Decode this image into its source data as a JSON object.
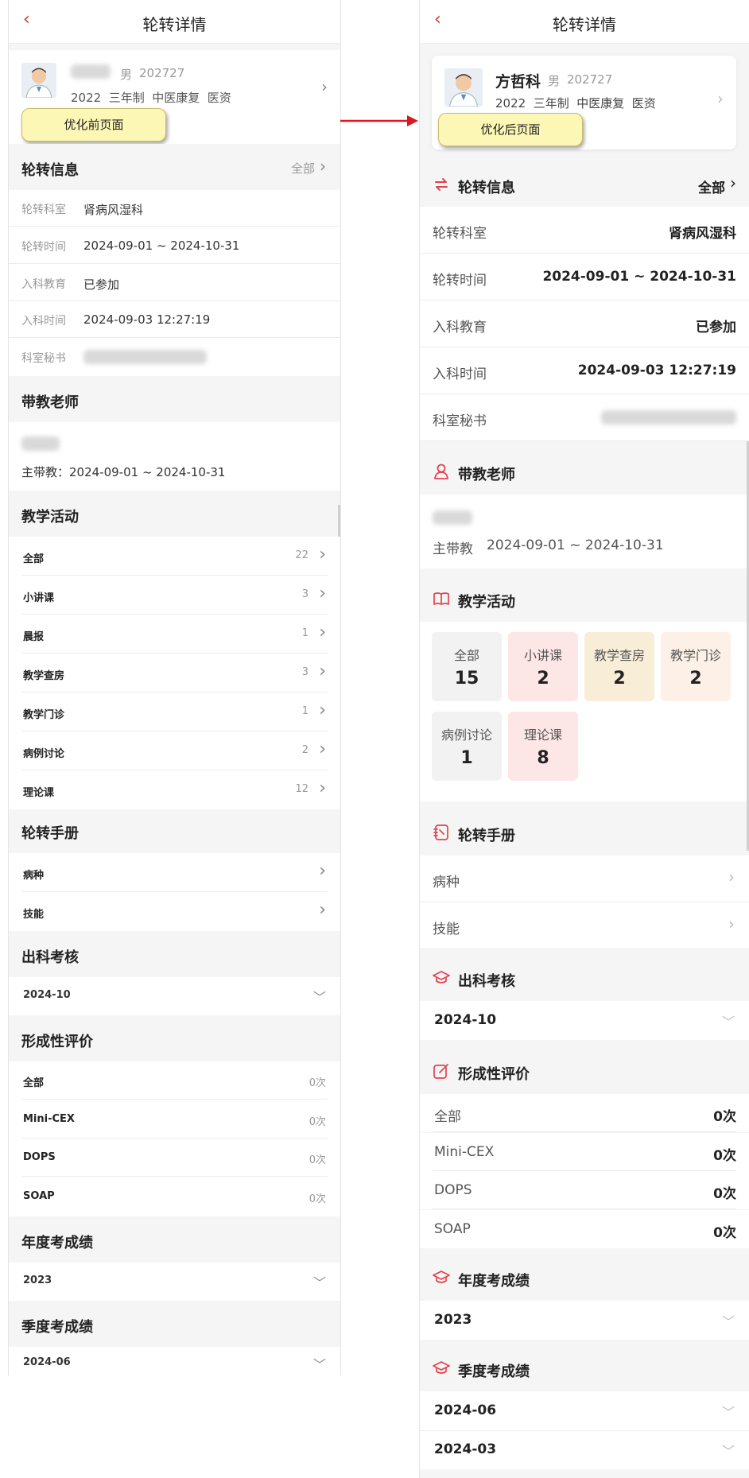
{
  "left": {
    "title": "轮转详情",
    "student": {
      "gender": "男",
      "id": "202727",
      "info": "2022  三年制  中医康复  医资"
    },
    "tooltip": "优化前页面",
    "rotation": {
      "header": "轮转信息",
      "all": "全部",
      "rows": [
        {
          "label": "轮转科室",
          "value": "肾病风湿科"
        },
        {
          "label": "轮转时间",
          "value": "2024-09-01 ~ 2024-10-31"
        },
        {
          "label": "入科教育",
          "value": "已参加"
        },
        {
          "label": "入科时间",
          "value": "2024-09-03 12:27:19"
        },
        {
          "label": "科室秘书",
          "value": ""
        }
      ]
    },
    "teacher": {
      "header": "带教老师",
      "line": "主带教：2024-09-01 ~ 2024-10-31"
    },
    "activities": {
      "header": "教学活动",
      "items": [
        {
          "label": "全部",
          "count": "22"
        },
        {
          "label": "小讲课",
          "count": "3"
        },
        {
          "label": "晨报",
          "count": "1"
        },
        {
          "label": "教学查房",
          "count": "3"
        },
        {
          "label": "教学门诊",
          "count": "1"
        },
        {
          "label": "病例讨论",
          "count": "2"
        },
        {
          "label": "理论课",
          "count": "12"
        }
      ]
    },
    "manual": {
      "header": "轮转手册",
      "items": [
        "病种",
        "技能"
      ]
    },
    "exam": {
      "header": "出科考核",
      "value": "2024-10"
    },
    "formative": {
      "header": "形成性评价",
      "items": [
        {
          "label": "全部",
          "value": "0次"
        },
        {
          "label": "Mini-CEX",
          "value": "0次"
        },
        {
          "label": "DOPS",
          "value": "0次"
        },
        {
          "label": "SOAP",
          "value": "0次"
        }
      ]
    },
    "annual": {
      "header": "年度考成绩",
      "value": "2023"
    },
    "quarterly": {
      "header": "季度考成绩",
      "value": "2024-06"
    }
  },
  "right": {
    "title": "轮转详情",
    "student": {
      "name": "方哲科",
      "gender": "男",
      "id": "202727",
      "info": "2022  三年制  中医康复  医资"
    },
    "tooltip": "优化后页面",
    "rotation": {
      "header": "轮转信息",
      "all": "全部",
      "rows": [
        {
          "label": "轮转科室",
          "value": "肾病风湿科"
        },
        {
          "label": "轮转时间",
          "value": "2024-09-01 ~ 2024-10-31"
        },
        {
          "label": "入科教育",
          "value": "已参加"
        },
        {
          "label": "入科时间",
          "value": "2024-09-03 12:27:19"
        },
        {
          "label": "科室秘书",
          "value": ""
        }
      ]
    },
    "teacher": {
      "header": "带教老师",
      "role": "主带教",
      "period": "2024-09-01 ~ 2024-10-31"
    },
    "activities": {
      "header": "教学活动",
      "tiles": [
        {
          "label": "全部",
          "count": "15",
          "color": "#f2f2f2"
        },
        {
          "label": "小讲课",
          "count": "2",
          "color": "#fde6e6"
        },
        {
          "label": "教学查房",
          "count": "2",
          "color": "#f8eed8"
        },
        {
          "label": "教学门诊",
          "count": "2",
          "color": "#fdf0e6"
        },
        {
          "label": "病例讨论",
          "count": "1",
          "color": "#f2f2f2"
        },
        {
          "label": "理论课",
          "count": "8",
          "color": "#fde6e6"
        }
      ]
    },
    "manual": {
      "header": "轮转手册",
      "items": [
        "病种",
        "技能"
      ]
    },
    "exam": {
      "header": "出科考核",
      "value": "2024-10"
    },
    "formative": {
      "header": "形成性评价",
      "items": [
        {
          "label": "全部",
          "value": "0次"
        },
        {
          "label": "Mini-CEX",
          "value": "0次"
        },
        {
          "label": "DOPS",
          "value": "0次"
        },
        {
          "label": "SOAP",
          "value": "0次"
        }
      ]
    },
    "annual": {
      "header": "年度考成绩",
      "value": "2023"
    },
    "quarterly": {
      "header": "季度考成绩",
      "values": [
        "2024-06",
        "2024-03"
      ]
    }
  },
  "colors": {
    "accent": "#e2434f",
    "arrow": "#d71921",
    "tooltip_bg": "#fdf7b5"
  },
  "icons": {
    "back": "‹",
    "chevron_right": "›",
    "chevron_down": "﹀",
    "rotation": "swap-icon",
    "teacher": "person-icon",
    "activities": "book-icon",
    "manual": "notebook-icon",
    "exam": "graduation-cap-icon",
    "formative": "edit-icon"
  }
}
